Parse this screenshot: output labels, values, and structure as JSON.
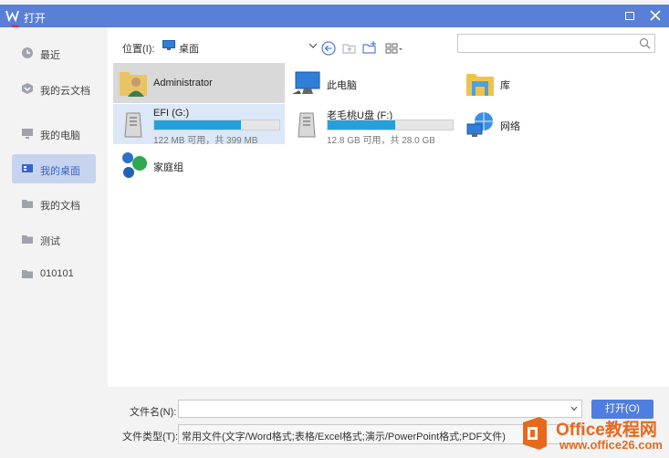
{
  "window": {
    "title": "打开"
  },
  "sidebar": {
    "items": [
      {
        "label": "最近",
        "icon": "clock-icon"
      },
      {
        "label": "我的云文档",
        "icon": "cloud-doc-icon"
      },
      {
        "label": "我的电脑",
        "icon": "computer-icon"
      },
      {
        "label": "我的桌面",
        "icon": "desktop-icon",
        "selected": true
      },
      {
        "label": "我的文档",
        "icon": "folder-icon"
      },
      {
        "label": "测试",
        "icon": "folder-icon"
      },
      {
        "label": "010101",
        "icon": "folder-icon"
      }
    ]
  },
  "location": {
    "label": "位置(I):",
    "value": "桌面"
  },
  "search": {
    "placeholder": ""
  },
  "items": [
    {
      "name": "Administrator",
      "type": "user-folder"
    },
    {
      "name": "此电脑",
      "type": "computer"
    },
    {
      "name": "库",
      "type": "library"
    },
    {
      "name": "EFI (G:)",
      "type": "drive",
      "usage": "122 MB 可用，共 399 MB",
      "used_fraction": 0.69
    },
    {
      "name": "老毛桃U盘 (F:)",
      "type": "drive",
      "usage": "12.8 GB 可用，共 28.0 GB",
      "used_fraction": 0.54
    },
    {
      "name": "网络",
      "type": "network"
    },
    {
      "name": "家庭组",
      "type": "homegroup"
    }
  ],
  "bottom": {
    "filename_label": "文件名(N):",
    "filename_value": "",
    "filetype_label": "文件类型(T):",
    "filetype_value": "常用文件(文字/Word格式;表格/Excel格式;演示/PowerPoint格式;PDF文件)",
    "open_label": "打开(O)"
  },
  "watermark": {
    "line1": "Office教程网",
    "line2": "www.office26.com"
  },
  "colors": {
    "titlebar": "#5a7fd6",
    "accent": "#4f7ee0",
    "selected_nav": "#c6d4ee",
    "drive_bar": "#26a0da"
  }
}
